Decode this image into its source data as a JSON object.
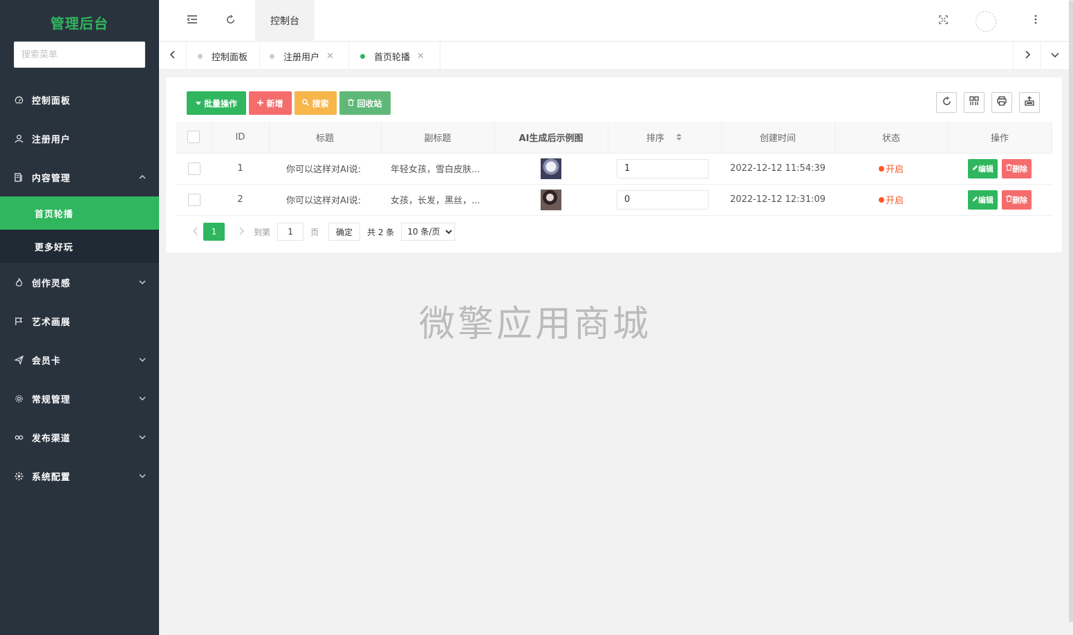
{
  "sidebar": {
    "logo": "管理后台",
    "search_placeholder": "搜索菜单",
    "items": [
      {
        "label": "控制面板",
        "icon": "dashboard-icon"
      },
      {
        "label": "注册用户",
        "icon": "user-icon"
      },
      {
        "label": "内容管理",
        "icon": "content-icon",
        "expanded": true,
        "children": [
          {
            "label": "首页轮播",
            "active": true
          },
          {
            "label": "更多好玩"
          }
        ]
      },
      {
        "label": "创作灵感",
        "icon": "fire-icon"
      },
      {
        "label": "艺术画展",
        "icon": "flag-icon"
      },
      {
        "label": "会员卡",
        "icon": "send-icon"
      },
      {
        "label": "常规管理",
        "icon": "gear-icon"
      },
      {
        "label": "发布渠道",
        "icon": "link-icon"
      },
      {
        "label": "系统配置",
        "icon": "cog-icon"
      }
    ]
  },
  "header": {
    "tab_label": "控制台"
  },
  "tabbar": {
    "tabs": [
      {
        "label": "控制面板",
        "closable": false
      },
      {
        "label": "注册用户",
        "closable": true
      },
      {
        "label": "首页轮播",
        "closable": true,
        "active": true
      }
    ],
    "close_glyph": "✕"
  },
  "toolbar": {
    "batch_label": "批量操作",
    "add_label": "新增",
    "search_label": "搜索",
    "recycle_label": "回收站"
  },
  "table": {
    "columns": [
      "ID",
      "标题",
      "副标题",
      "AI生成后示例图",
      "排序",
      "创建时间",
      "状态",
      "操作"
    ],
    "rows": [
      {
        "id": "1",
        "title": "你可以这样对AI说:",
        "subtitle": "年轻女孩，雪白皮肤...",
        "sort": "1",
        "created": "2022-12-12 11:54:39",
        "status": "开启"
      },
      {
        "id": "2",
        "title": "你可以这样对AI说:",
        "subtitle": "女孩，长发，黑丝，...",
        "sort": "0",
        "created": "2022-12-12 12:31:09",
        "status": "开启"
      }
    ],
    "edit_label": "编辑",
    "delete_label": "删除"
  },
  "pager": {
    "current": "1",
    "goto_label": "到第",
    "goto_value": "1",
    "page_unit": "页",
    "confirm_label": "确定",
    "total": "共 2 条",
    "page_size": "10 条/页"
  },
  "watermark": "微擎应用商城",
  "colors": {
    "sidebar_bg": "#28333e",
    "accent": "#2fb65e",
    "danger": "#f56c6c",
    "warning": "#f7b54a"
  }
}
